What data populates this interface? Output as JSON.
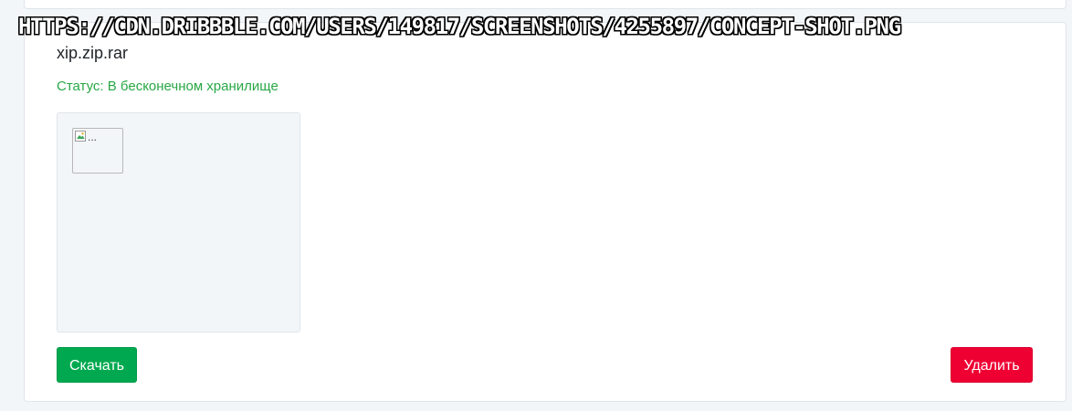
{
  "overlay": {
    "url_text": "https://cdn.dribbble.com/users/149817/screenshots/4255897/concept-shot.png"
  },
  "file": {
    "name": "xip.zip.rar",
    "status": "Статус: В бесконечном хранилище",
    "preview_alt": "..."
  },
  "actions": {
    "download_label": "Скачать",
    "delete_label": "Удалить"
  },
  "colors": {
    "status_green": "#28a745",
    "download_green": "#00a94f",
    "delete_red": "#ee0033",
    "page_background": "#f3f6f9"
  },
  "icons": {
    "preview": "broken-image-icon"
  }
}
